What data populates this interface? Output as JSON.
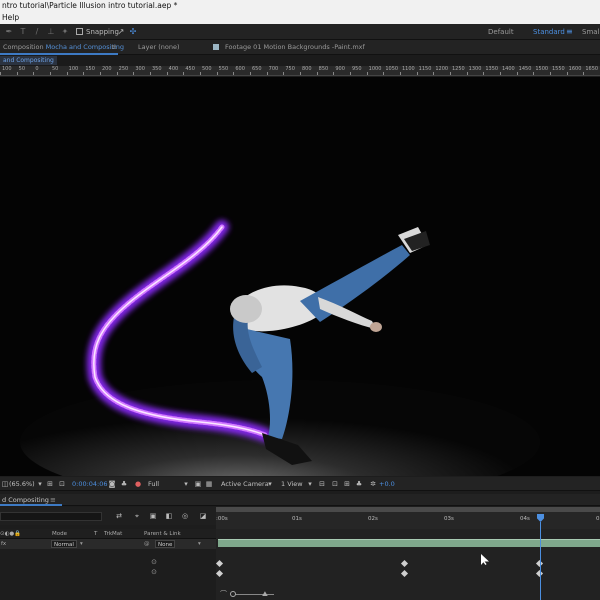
{
  "window": {
    "title": "ntro tutorial\\Particle Illusion intro tutorial.aep *"
  },
  "menubar": {
    "items": [
      "Help"
    ]
  },
  "toolbar": {
    "snapping_label": "Snapping",
    "workspaces": [
      "Default",
      "Standard",
      "Small"
    ],
    "active_workspace": "Standard",
    "workspace_menu_icon": "double-chevron-right-icon"
  },
  "panel_tabs": {
    "composition_prefix": "Composition",
    "composition_name": "Mocha and Compositing",
    "layer_tab": "Layer (none)",
    "footage_tab": "Footage 01 Motion Backgrounds -Paint.mxf"
  },
  "viewer": {
    "subtab": "and Compositing",
    "ruler_labels": [
      "100",
      "50",
      "0",
      "50",
      "100",
      "150",
      "200",
      "250",
      "300",
      "350",
      "400",
      "450",
      "500",
      "550",
      "600",
      "650",
      "700",
      "750",
      "800",
      "850",
      "900",
      "950",
      "1000",
      "1050",
      "1100",
      "1150",
      "1200",
      "1250",
      "1300",
      "1350",
      "1400",
      "1450",
      "1500",
      "1550",
      "1600",
      "1650"
    ]
  },
  "viewer_controls": {
    "zoom": "(65.6%)",
    "timecode": "0:00:04:06",
    "resolution": "Full",
    "camera": "Active Camera",
    "views": "1 View",
    "exposure": "+0.0"
  },
  "timeline": {
    "tab_label": "d Compositing",
    "time_labels": [
      ":00s",
      "01s",
      "02s",
      "03s",
      "04s",
      "05"
    ],
    "columns": {
      "mode": "Mode",
      "t": "T",
      "trkmat": "TrkMat",
      "parent": "Parent & Link"
    },
    "layer": {
      "mode": "Normal",
      "parent": "None"
    }
  },
  "colors": {
    "accent": "#4c8fe0",
    "layer_bar": "#7fa88c",
    "streak_core": "#f0b8ff",
    "streak_glow": "#9b3cff"
  }
}
